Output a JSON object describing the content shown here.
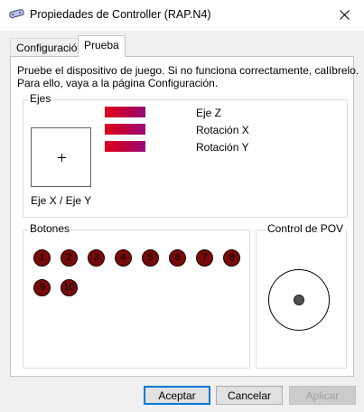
{
  "window": {
    "title": "Propiedades de Controller (RAP.N4)",
    "icon": "gamepad-icon"
  },
  "tabs": [
    {
      "label": "Configuración",
      "active": false
    },
    {
      "label": "Prueba",
      "active": true
    }
  ],
  "instructions": {
    "line1": "Pruebe el dispositivo de juego. Si no funciona correctamente, calíbrelo.",
    "line2": "Para ello, vaya a la página Configuración."
  },
  "axes": {
    "group_label": "Ejes",
    "xy_label": "Eje X / Eje Y",
    "bars": [
      {
        "label": "Eje Z"
      },
      {
        "label": "Rotación X"
      },
      {
        "label": "Rotación Y"
      }
    ],
    "bar_color_start": "#e1001e",
    "bar_color_end": "#9a0a7a"
  },
  "buttons_group": {
    "group_label": "Botones",
    "buttons": [
      "1",
      "2",
      "3",
      "4",
      "5",
      "6",
      "7",
      "8",
      "9",
      "10"
    ],
    "button_color": "#770a0a"
  },
  "pov": {
    "group_label": "Control de POV"
  },
  "dialog_buttons": {
    "accept": "Aceptar",
    "cancel": "Cancelar",
    "apply": "Aplicar"
  }
}
